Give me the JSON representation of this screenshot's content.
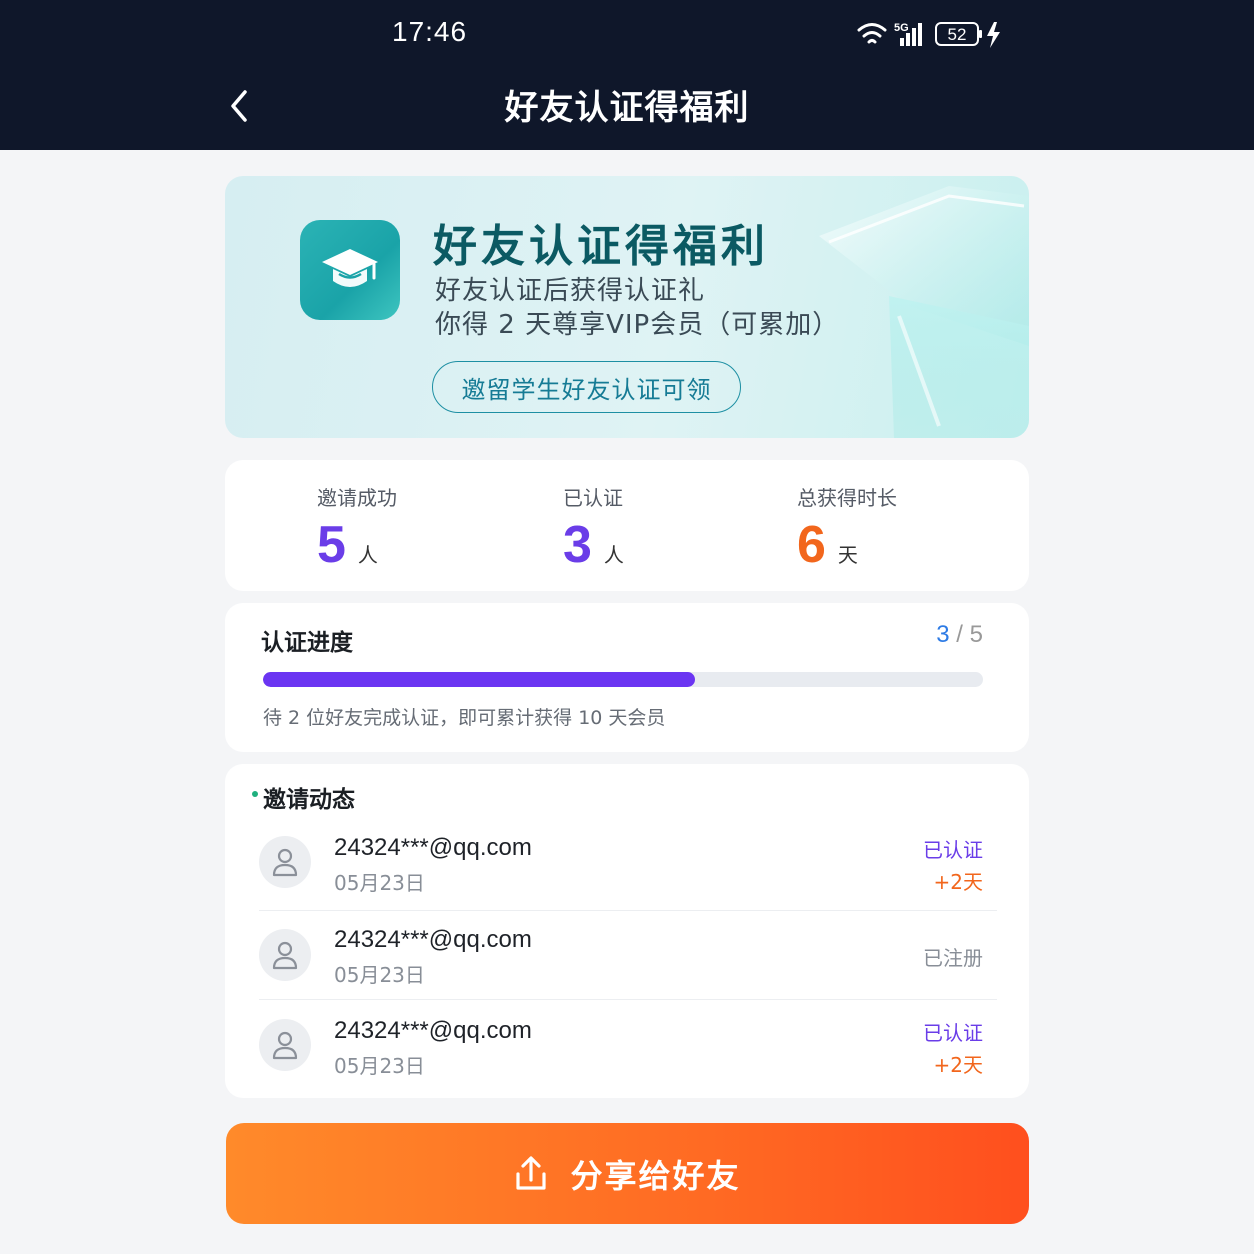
{
  "status_bar": {
    "time": "17:46",
    "network": "5G",
    "battery": "52"
  },
  "nav": {
    "title": "好友认证得福利"
  },
  "hero": {
    "title": "好友认证得福利",
    "line1": "好友认证后获得认证礼",
    "line2": "你得 2 天尊享VIP会员（可累加）",
    "cta": "邀留学生好友认证可领",
    "icon": "graduation-cap-icon"
  },
  "stats": [
    {
      "label": "邀请成功",
      "value": "5",
      "unit": "人",
      "color": "#6a3de8"
    },
    {
      "label": "已认证",
      "value": "3",
      "unit": "人",
      "color": "#6a3de8"
    },
    {
      "label": "总获得时长",
      "value": "6",
      "unit": "天",
      "color": "#f2661c"
    }
  ],
  "progress": {
    "title": "认证进度",
    "current": "3",
    "separator": " / ",
    "total": "5",
    "fraction": 0.6,
    "note": "待 2 位好友完成认证，即可累计获得 10 天会员"
  },
  "activity": {
    "title": "邀请动态",
    "items": [
      {
        "email": "24324***@qq.com",
        "date": "05月23日",
        "status": "已认证",
        "bonus": "+2天"
      },
      {
        "email": "24324***@qq.com",
        "date": "05月23日",
        "status": "已注册",
        "bonus": ""
      },
      {
        "email": "24324***@qq.com",
        "date": "05月23日",
        "status": "已认证",
        "bonus": "+2天"
      }
    ]
  },
  "share": {
    "label": "分享给好友",
    "icon": "share-upload-icon"
  },
  "colors": {
    "topbar": "#0f172a",
    "accent_purple": "#6a3de8",
    "accent_orange": "#f2661c",
    "progress_fill": "#6b35f2"
  }
}
